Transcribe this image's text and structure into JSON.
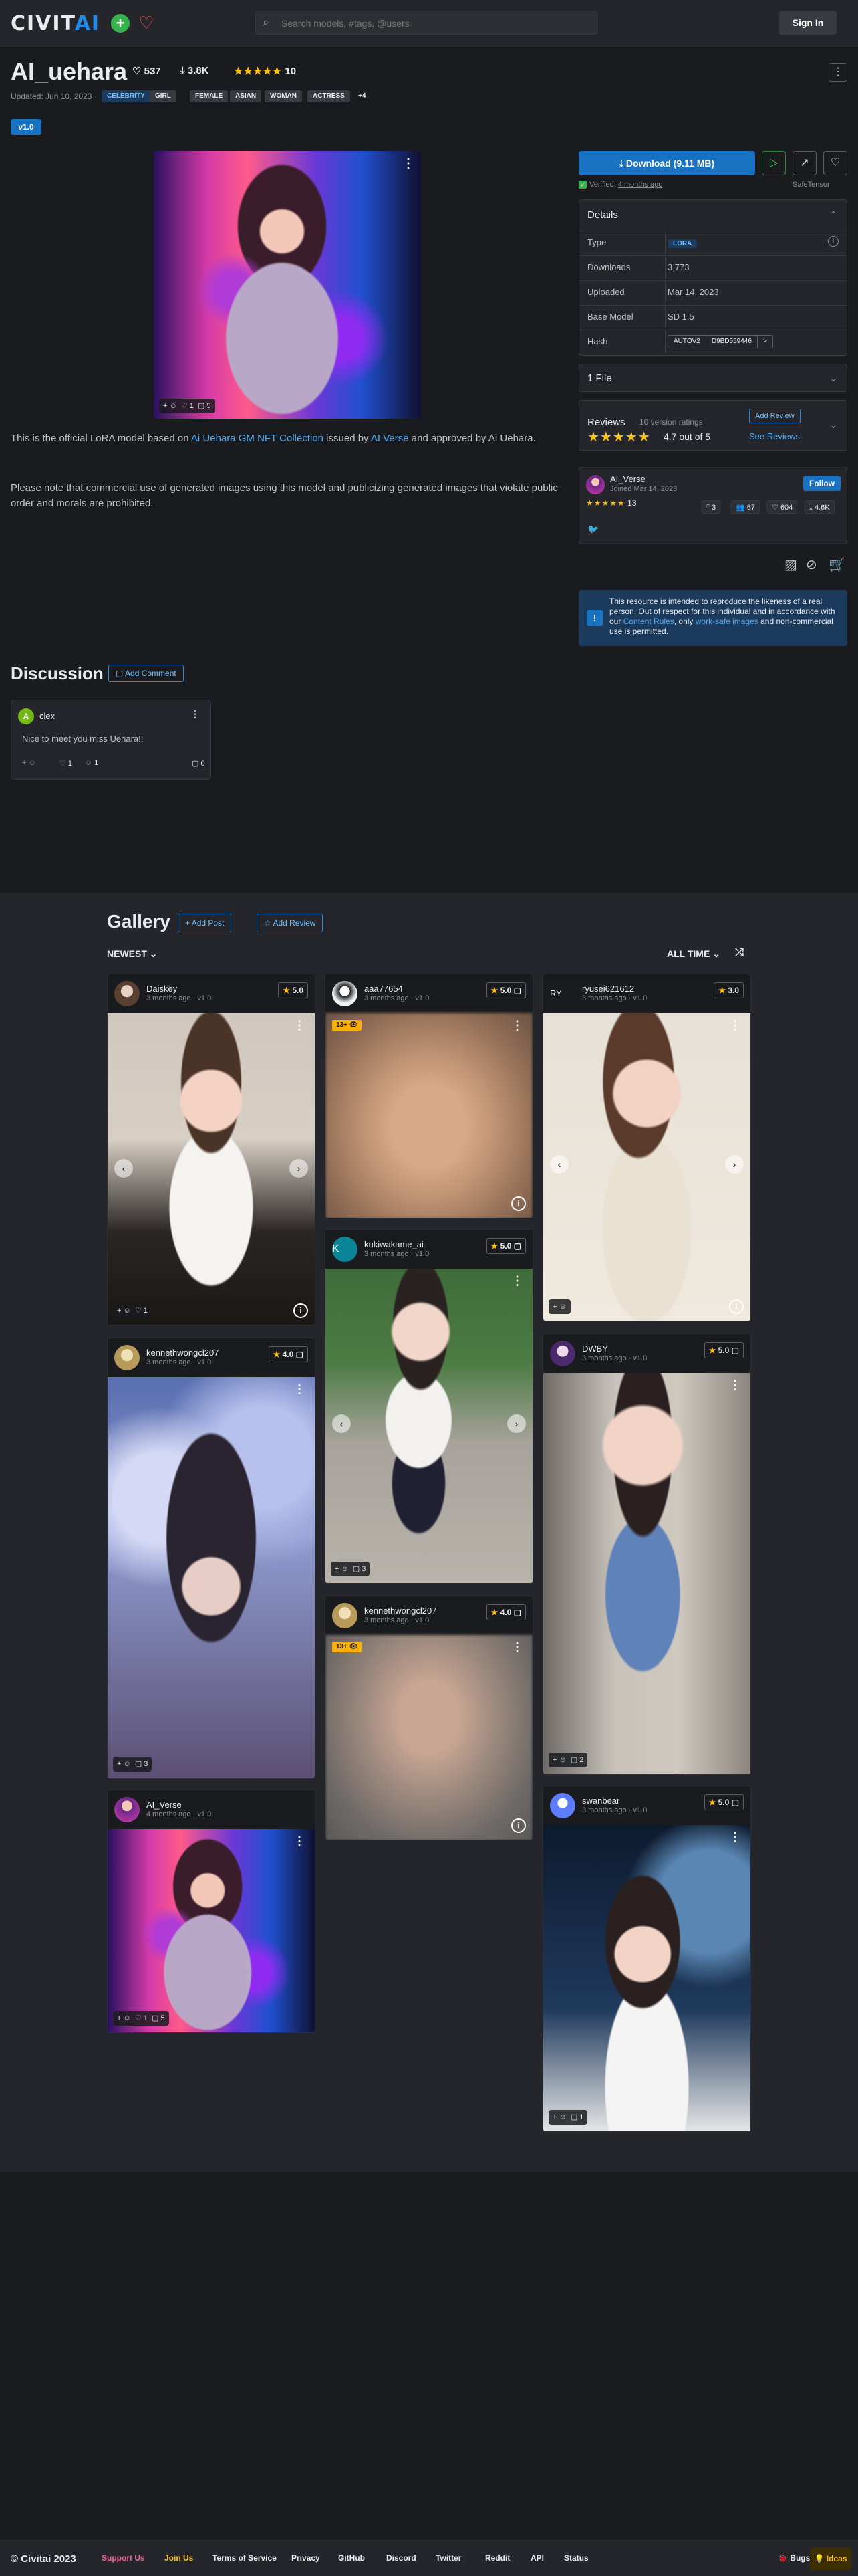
{
  "header": {
    "logo_main": "CIVIT",
    "logo_ai": "AI",
    "search_placeholder": "Search models, #tags, @users",
    "signin_label": "Sign In"
  },
  "model": {
    "name": "AI_uehara",
    "likes": "537",
    "downloads": "3.8K",
    "rating_stars": "★★★★★",
    "rating_count": "10",
    "updated": "Updated: Jun 10, 2023",
    "tags": [
      "CELEBRITY",
      "GIRL",
      "FEMALE",
      "ASIAN",
      "WOMAN",
      "ACTRESS",
      "+4"
    ],
    "version": "v1.0",
    "main_image_reacts": {
      "likes": "1",
      "comments": "5"
    },
    "description_p1_a": "This is the official LoRA model based on ",
    "description_link1": "Ai Uehara GM NFT Collection",
    "description_p1_b": " issued by ",
    "description_link2": "AI Verse",
    "description_p1_c": " and approved by Ai Uehara.",
    "description_p2": "Please note that commercial use of generated images using this model and publicizing generated images that violate public order and morals are prohibited."
  },
  "sidebar": {
    "download_label": "Download (9.11 MB)",
    "verified_label": "Verified:",
    "verified_time": "4 months ago",
    "safetensor": "SafeTensor",
    "details_title": "Details",
    "details": [
      {
        "key": "Type",
        "value": "LORA"
      },
      {
        "key": "Downloads",
        "value": "3,773"
      },
      {
        "key": "Uploaded",
        "value": "Mar 14, 2023"
      },
      {
        "key": "Base Model",
        "value": "SD 1.5"
      },
      {
        "key": "Hash",
        "value": ""
      }
    ],
    "hash_type": "AUTOV2",
    "hash_value": "D9BD559446",
    "hash_arrow": ">",
    "files_label": "1 File",
    "reviews_label": "Reviews",
    "reviews_count": "10 version ratings",
    "reviews_stars": "★★★★★",
    "reviews_score": "4.7 out of 5",
    "add_review": "Add Review",
    "see_reviews": "See Reviews",
    "creator_name": "AI_Verse",
    "creator_joined": "Joined Mar 14, 2023",
    "creator_stars": "★★★★★",
    "creator_rating_count": "13",
    "follow_label": "Follow",
    "creator_stats": [
      "3",
      "67",
      "604",
      "4.6K"
    ],
    "notice_a": "This resource is intended to reproduce the likeness of a real person. Out of respect for this individual and in accordance with our ",
    "notice_link1": "Content Rules",
    "notice_b": ", only ",
    "notice_link2": "work-safe images",
    "notice_c": " and non-commercial use is permitted."
  },
  "discussion": {
    "title": "Discussion",
    "add_comment": "Add Comment",
    "comment": {
      "avatar_letter": "A",
      "user": "clex",
      "text": "Nice to meet you miss Uehara!!",
      "likes": "1",
      "replies": "1",
      "comments": "0"
    }
  },
  "gallery": {
    "title": "Gallery",
    "add_post": "Add Post",
    "add_review": "Add Review",
    "sort_left": "NEWEST",
    "sort_right": "ALL TIME",
    "nsfw_badge": "13+",
    "cards": [
      {
        "user": "Daiskey",
        "meta": "3 months ago · v1.0",
        "rating": "5.0",
        "reacts": "1"
      },
      {
        "user": "aaa77654",
        "meta": "3 months ago · v1.0",
        "rating": "5.0",
        "reacts": ""
      },
      {
        "user": "ryusei621612",
        "meta": "3 months ago · v1.0",
        "rating": "3.0",
        "reacts": "",
        "avatar_letters": "RY"
      },
      {
        "user": "kennethwongcl207",
        "meta": "3 months ago · v1.0",
        "rating": "4.0",
        "reacts": "3"
      },
      {
        "user": "kukiwakame_ai",
        "meta": "3 months ago · v1.0",
        "rating": "5.0",
        "reacts": "3",
        "avatar_letters": "K"
      },
      {
        "user": "kennethwongcl207",
        "meta": "3 months ago · v1.0",
        "rating": "4.0",
        "reacts": ""
      },
      {
        "user": "DWBY",
        "meta": "3 months ago · v1.0",
        "rating": "5.0",
        "reacts": "2"
      },
      {
        "user": "AI_Verse",
        "meta": "4 months ago · v1.0",
        "rating": "",
        "reacts": "1",
        "reacts2": "5"
      },
      {
        "user": "swanbear",
        "meta": "3 months ago · v1.0",
        "rating": "5.0",
        "reacts": "1"
      }
    ]
  },
  "footer": {
    "copyright": "© Civitai 2023",
    "links": [
      "Support Us",
      "Join Us",
      "Terms of Service",
      "Privacy",
      "GitHub",
      "Discord",
      "Twitter",
      "Reddit",
      "API",
      "Status"
    ],
    "bugs": "Bugs",
    "ideas": "Ideas"
  }
}
